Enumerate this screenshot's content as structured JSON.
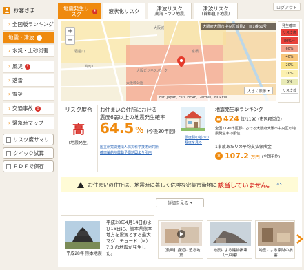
{
  "sidebar": {
    "header": "お客さま",
    "items": [
      {
        "label": "全国版ランキング",
        "badge": ""
      },
      {
        "label": "地震・津波",
        "badge": "!"
      },
      {
        "label": "水災・土砂災害",
        "badge": ""
      },
      {
        "label": "風災",
        "badge": "!"
      },
      {
        "label": "落雷",
        "badge": ""
      },
      {
        "label": "雪災",
        "badge": ""
      },
      {
        "label": "交通事故",
        "badge": "!"
      },
      {
        "label": "緊急時マップ",
        "badge": ""
      }
    ],
    "buttons": [
      "リスク度サマリ",
      "クイック試算",
      "ＰＤＦで保存"
    ]
  },
  "tabs": [
    {
      "label": "地震発生リスク",
      "badge": "!"
    },
    {
      "label": "液状化リスク",
      "sub": ""
    },
    {
      "label": "津波リスク",
      "sub": "(南海トラフ地震)"
    },
    {
      "label": "津波リスク",
      "sub": "(首都直下地震)"
    }
  ],
  "logout": "ログアウト",
  "map": {
    "address": "大阪府大阪市中央区城見2丁目1番61号",
    "attribution": "Esri Japan, Esri, HERE, Garmin, INCREM",
    "zoom_plus": "+",
    "zoom_minus": "−",
    "size_button": "大きく表示",
    "place_labels": [
      "大阪城",
      "京橋",
      "大阪ビジネスパーク",
      "大阪城公園",
      "片町1",
      "寝屋川"
    ]
  },
  "legend": {
    "title": "発生確率",
    "rows": [
      {
        "label": "80%～",
        "color": "#e8403a"
      },
      {
        "label": "60%",
        "color": "#f2a08a"
      },
      {
        "label": "40%",
        "color": "#f8c57b"
      },
      {
        "label": "20%",
        "color": "#f9e28a"
      },
      {
        "label": "10%",
        "color": "#fcf1b0"
      },
      {
        "label": "5%",
        "color": "#e8eab5"
      },
      {
        "label": "リスク低",
        "color": "#fff"
      },
      {
        "label": "",
        "color": "#fff"
      }
    ],
    "footer": "リスク高"
  },
  "risk": {
    "title": "リスク度合",
    "level": "高",
    "sub": "(地震発生)"
  },
  "prob": {
    "line1": "お住まいの住所における",
    "line2": "震度6弱以上の地震発生確率",
    "value": "64.5",
    "unit": "%",
    "note": "(今後30年間)",
    "source1": "国立研究開発法人防災科学技術研究所",
    "source2": "確率論的地震動予測地図より引用",
    "house_note1": "震度別の揺れの",
    "house_note2": "程度を見る"
  },
  "ranking": {
    "title": "地震発生率ランキング",
    "rank": "424",
    "rank_suffix": "位/1190 (市区郡単位)",
    "desc": "全国1190市区郡における大阪府大阪市中央区の地震発生率の順位",
    "payout_title": "1事故あたりの平均支払保険金",
    "amount": "107.2",
    "amount_unit": "万円",
    "amount_note": "(全国平均)"
  },
  "warning": {
    "text": "お住まいの住所は、地震時に著しく危険な密集市街地に",
    "highlight": "該当していません。",
    "tail": "※5"
  },
  "detail_button": "詳細を見る",
  "news": [
    {
      "caption": "平成28年 熊本地震",
      "text": "平成28年4月14日および16日に、熊本県熊本地方を震源とする最大マグニチュード（M）7.3 の地震が発生した。"
    },
    {
      "caption": "【動画】身近に迫る地震"
    },
    {
      "caption": "地震による建物損壊（一戸建）"
    },
    {
      "caption": "地震による家財の損害"
    }
  ],
  "colors": {
    "accent": "#ef8a0e",
    "danger": "#d8312a",
    "highlight_text": "#d8312a"
  }
}
